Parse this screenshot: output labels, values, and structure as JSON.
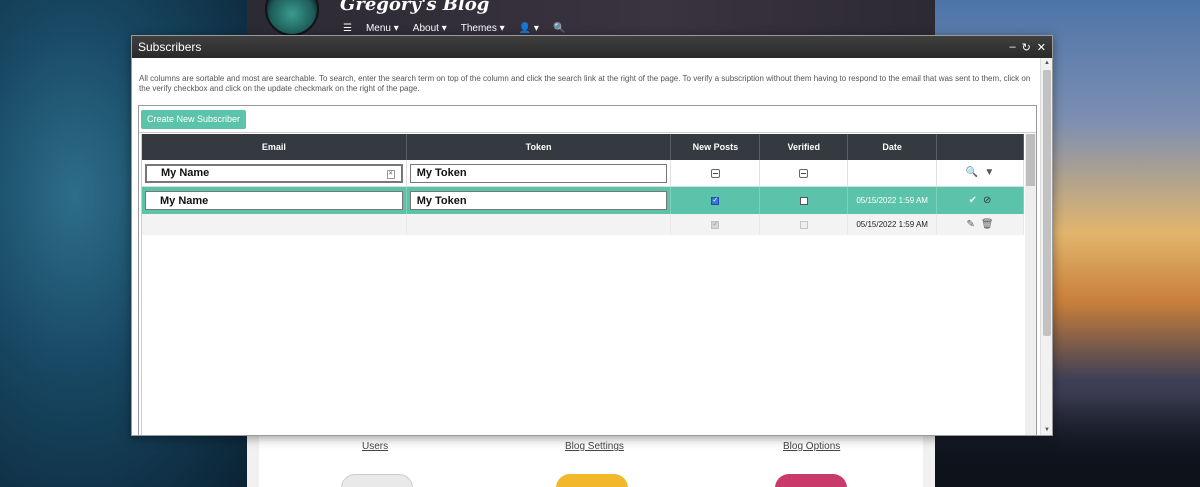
{
  "blog": {
    "title": "Gregory's Blog",
    "nav": [
      "Menu",
      "About",
      "Themes"
    ],
    "nav_icons": [
      "hamburger-icon",
      "user-icon",
      "search-icon"
    ],
    "links": [
      "Users",
      "Blog Settings",
      "Blog Options"
    ]
  },
  "dialog": {
    "title": "Subscribers",
    "controls": [
      "minimize-icon",
      "refresh-icon",
      "close-icon"
    ],
    "intro": "All columns are sortable and most are searchable. To search, enter the search term on top of the column and click the search link at the right of the page. To verify a subscription without them having to respond to the email that was sent to them, click on the verify checkbox and click on the update checkmark on the right of the page."
  },
  "grid": {
    "create_button": "Create New Subscriber",
    "columns": [
      "Email",
      "Token",
      "New Posts",
      "Verified",
      "Date"
    ],
    "filter": {
      "email": "My Name",
      "token": "My Token"
    },
    "edit_row": {
      "email": "My Name",
      "token": "My Token",
      "new_posts": true,
      "verified": false,
      "date": "05/15/2022 1:59 AM"
    },
    "data_row": {
      "email": "",
      "token": "",
      "new_posts": true,
      "verified": false,
      "date": "05/15/2022 1:59 AM"
    }
  },
  "colors": {
    "accent": "#5bc3a9",
    "header": "#343a40",
    "titlebar": "#333333"
  }
}
